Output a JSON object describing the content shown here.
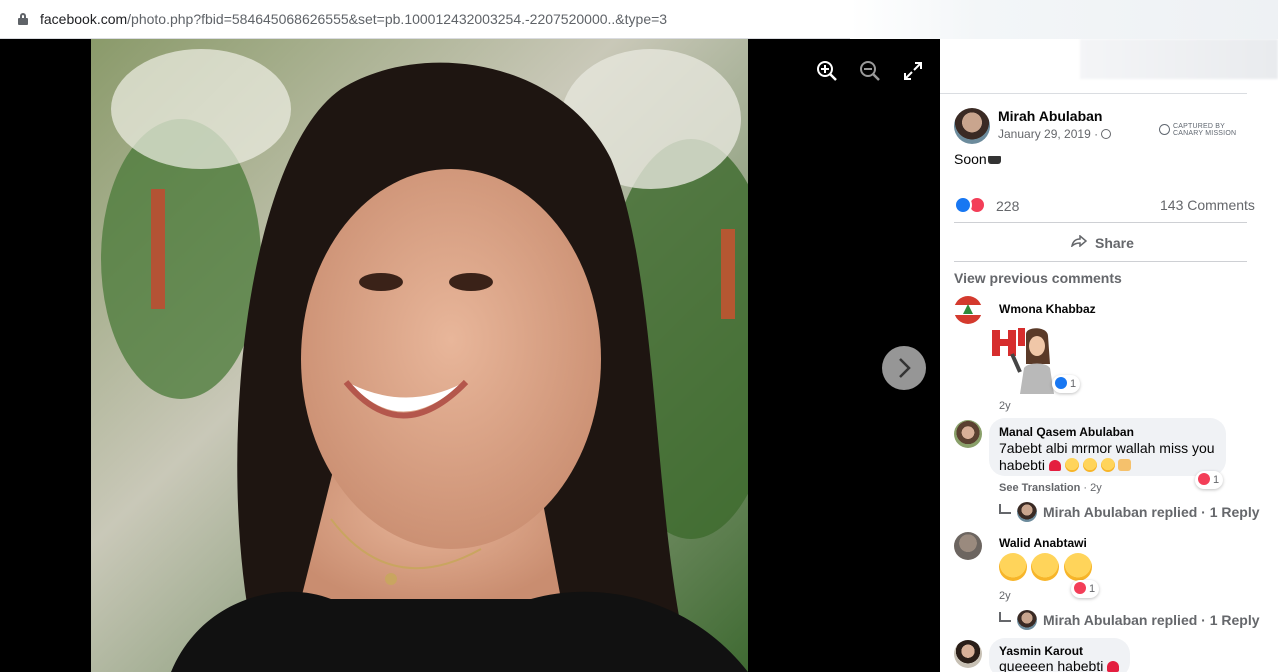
{
  "browser": {
    "url_domain": "facebook.com",
    "url_rest": "/photo.php?fbid=584645068626555&set=pb.100012432003254.-2207520000..&type=3"
  },
  "viewer": {
    "controls": [
      "zoom-in-icon",
      "zoom-out-icon",
      "fullscreen-icon"
    ],
    "next_icon": "chevron-right-icon"
  },
  "post": {
    "author": "Mirah Abulaban",
    "date": "January 29, 2019 ·",
    "watermark_line1": "CAPTURED BY",
    "watermark_line2": "CANARY MISSION",
    "text": "Soon",
    "reaction_count": "228",
    "comment_count": "143 Comments",
    "share_label": "Share",
    "view_previous": "View previous comments"
  },
  "comments": [
    {
      "name": "Wmona Khabbaz",
      "sticker": "HI",
      "reaction_count": "1",
      "time": "2y"
    },
    {
      "name": "Manal Qasem Abulaban",
      "text_line1": "7abebt albi mrmor wallah miss you",
      "text_line2": "habebti",
      "see_translation": "See Translation",
      "time": "· 2y",
      "reaction_count": "1",
      "reply_text": "Mirah Abulaban replied · 1 Reply"
    },
    {
      "name": "Walid Anabtawi",
      "time": "2y",
      "reaction_count": "1",
      "reply_text": "Mirah Abulaban replied · 1 Reply"
    },
    {
      "name": "Yasmin Karout",
      "text": "queeeen habebti"
    }
  ],
  "colors": {
    "facebook_blue": "#1877f2",
    "love_red": "#f33e58",
    "secondary_text": "#65676b"
  }
}
